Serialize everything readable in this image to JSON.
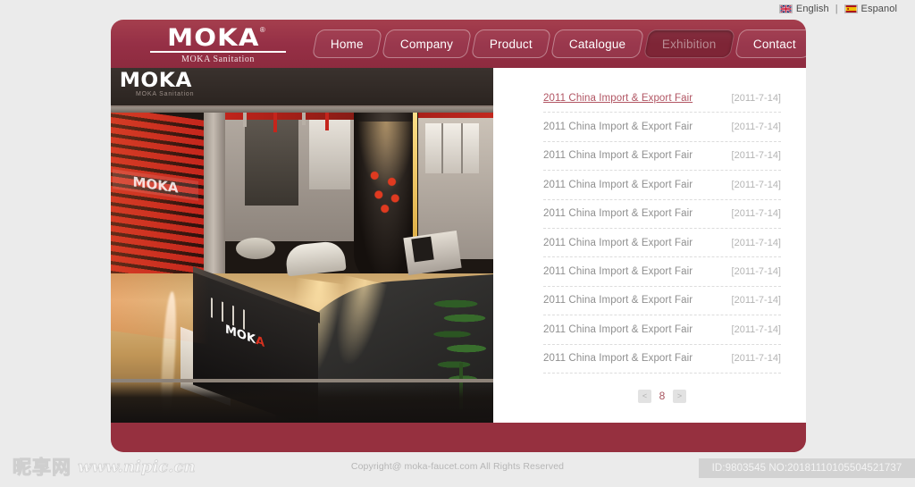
{
  "lang_bar": {
    "english_label": "English",
    "separator": "|",
    "espanol_label": "Espanol",
    "english_flag_icon": "uk-flag-icon",
    "espanol_flag_icon": "spain-flag-icon"
  },
  "header": {
    "logo_word": "MOKA",
    "logo_registered": "®",
    "logo_subtitle": "MOKA Sanitation",
    "brand_color": "#963046",
    "active_nav_color": "#7e2536",
    "nav": [
      {
        "label": "Home",
        "active": false
      },
      {
        "label": "Company",
        "active": false
      },
      {
        "label": "Product",
        "active": false
      },
      {
        "label": "Catalogue",
        "active": false
      },
      {
        "label": "Exhibition",
        "active": true
      },
      {
        "label": "Contact",
        "active": false
      }
    ]
  },
  "showroom": {
    "overlay_logo": "MOKA",
    "overlay_logo_sub": "MOKA Sanitation",
    "counter_logo": "MOK",
    "counter_logo_accent": "A",
    "wall_logo": "MOKA",
    "alt": "MOKA sanitation exhibition showroom interior render"
  },
  "news": {
    "items": [
      {
        "title": "2011 China Import & Export Fair",
        "date": "[2011-7-14]",
        "active": true
      },
      {
        "title": "2011 China Import & Export Fair",
        "date": "[2011-7-14]",
        "active": false
      },
      {
        "title": "2011 China Import & Export Fair",
        "date": "[2011-7-14]",
        "active": false
      },
      {
        "title": "2011 China Import & Export Fair",
        "date": "[2011-7-14]",
        "active": false
      },
      {
        "title": "2011 China Import & Export Fair",
        "date": "[2011-7-14]",
        "active": false
      },
      {
        "title": "2011 China Import & Export Fair",
        "date": "[2011-7-14]",
        "active": false
      },
      {
        "title": "2011 China Import & Export Fair",
        "date": "[2011-7-14]",
        "active": false
      },
      {
        "title": "2011 China Import & Export Fair",
        "date": "[2011-7-14]",
        "active": false
      },
      {
        "title": "2011 China Import & Export Fair",
        "date": "[2011-7-14]",
        "active": false
      },
      {
        "title": "2011 China Import & Export Fair",
        "date": "[2011-7-14]",
        "active": false
      }
    ],
    "link_color": "#b15563",
    "text_color": "#8f8f8f"
  },
  "pagination": {
    "prev_label": "<",
    "page_number": "8",
    "next_label": ">"
  },
  "footer": {
    "copyright": "Copyright@ moka-faucet.com All Rights Reserved"
  },
  "watermark": {
    "cn_text": "昵享网",
    "url_text": "www.nipic.cn"
  },
  "id_bar": {
    "text": "ID:9803545 NO:20181110105504521737"
  }
}
